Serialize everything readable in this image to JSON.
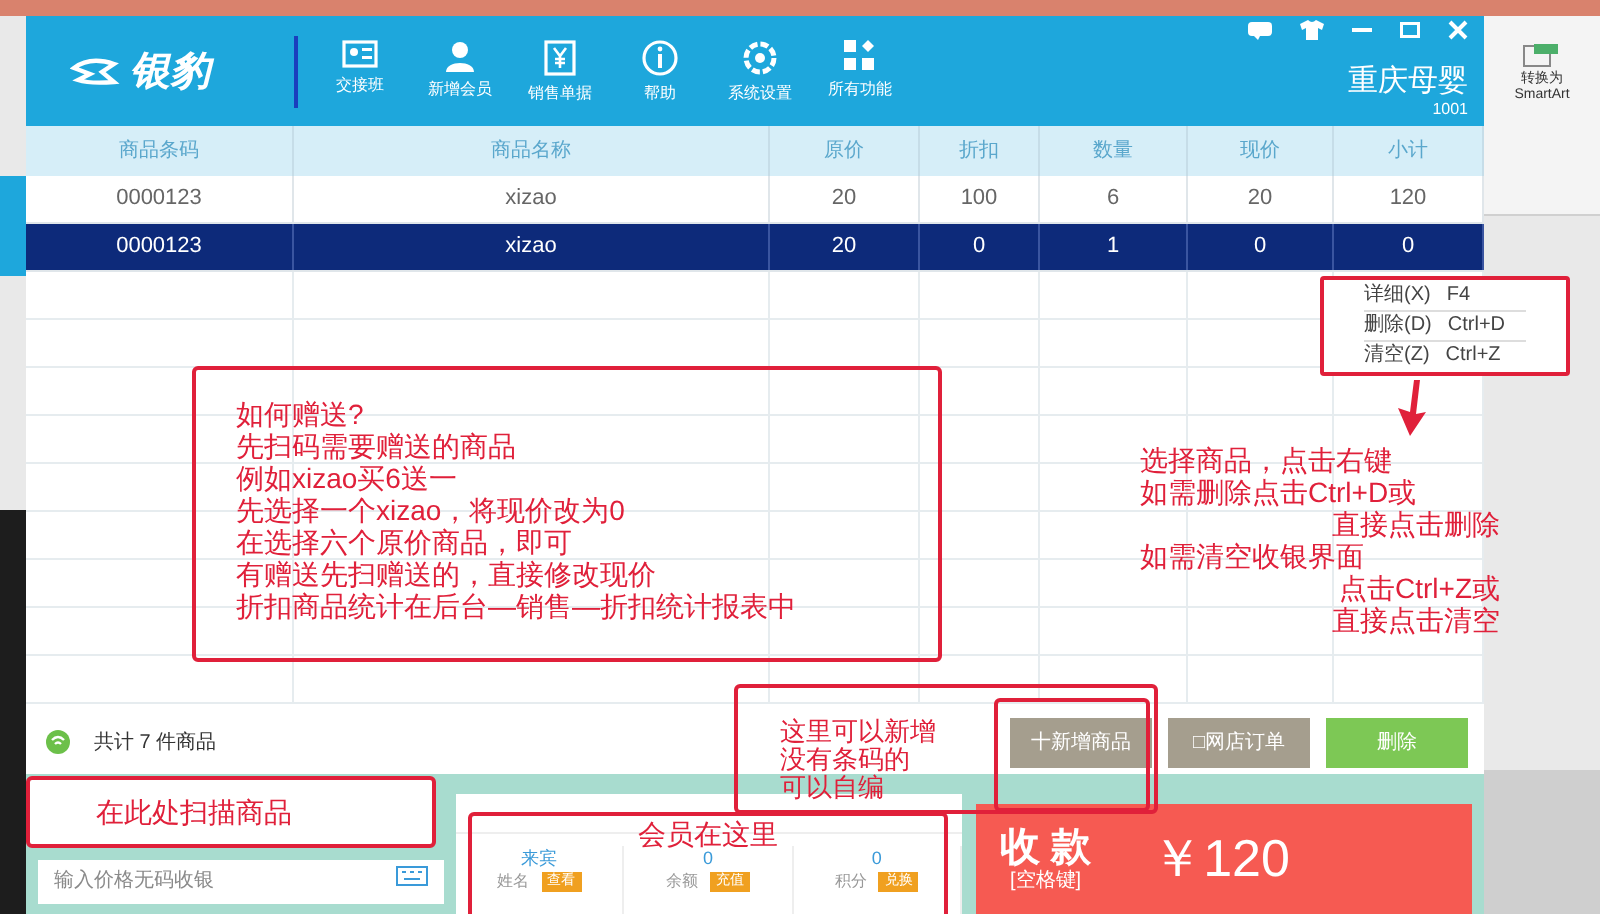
{
  "ribbon": {
    "button": "转换为\nSmartArt"
  },
  "header": {
    "logo": "银豹",
    "toolbar": [
      {
        "label": "交接班"
      },
      {
        "label": "新增会员"
      },
      {
        "label": "销售单据"
      },
      {
        "label": "帮助"
      },
      {
        "label": "系统设置"
      },
      {
        "label": "所有功能"
      }
    ],
    "store": "重庆母婴",
    "store_id": "1001"
  },
  "table": {
    "columns": [
      "商品条码",
      "商品名称",
      "原价",
      "折扣",
      "数量",
      "现价",
      "小计"
    ],
    "rows": [
      {
        "cells": [
          "0000123",
          "xizao",
          "20",
          "100",
          "6",
          "20",
          "120"
        ],
        "selected": false
      },
      {
        "cells": [
          "0000123",
          "xizao",
          "20",
          "0",
          "1",
          "0",
          "0"
        ],
        "selected": true
      }
    ]
  },
  "context_menu": [
    {
      "label": "详细(X)",
      "shortcut": "F4"
    },
    {
      "label": "删除(D)",
      "shortcut": "Ctrl+D"
    },
    {
      "label": "清空(Z)",
      "shortcut": "Ctrl+Z"
    }
  ],
  "footer": {
    "total": "共计 7 件商品",
    "buttons": [
      {
        "label": "十新增商品",
        "kind": "gray"
      },
      {
        "label": "□网店订单",
        "kind": "gray"
      },
      {
        "label": "删除",
        "kind": "green"
      }
    ]
  },
  "scan": {
    "fields": [
      {
        "placeholder": "输入价格无码收银"
      }
    ]
  },
  "member": {
    "stats": [
      {
        "value": "来宾",
        "label": "姓名",
        "action": "查看"
      },
      {
        "value": "0",
        "label": "余额",
        "action": "充值"
      },
      {
        "value": "0",
        "label": "积分",
        "action": "兑换"
      }
    ]
  },
  "pay": {
    "label": "收 款",
    "hint": "[空格键]",
    "amount": "￥120"
  },
  "notes": {
    "gift": [
      "如何赠送?",
      "先扫码需要赠送的商品",
      "例如xizao买6送一",
      "先选择一个xizao，将现价改为0",
      "在选择六个原价商品，即可",
      "有赠送先扫赠送的，直接修改现价",
      "折扣商品统计在后台—销售—折扣统计报表中"
    ],
    "right_click": [
      {
        "text": "选择商品，点击右键",
        "indent": false
      },
      {
        "text": "如需删除点击Ctrl+D或",
        "indent": false
      },
      {
        "text": "直接点击删除",
        "indent": true
      },
      {
        "text": "如需清空收银界面",
        "indent": false
      },
      {
        "text": "点击Ctrl+Z或",
        "indent": true
      },
      {
        "text": "直接点击清空",
        "indent": true
      }
    ],
    "add": [
      "这里可以新增",
      "没有条码的",
      "可以自编"
    ],
    "scan": "在此处扫描商品",
    "member": "会员在这里"
  }
}
